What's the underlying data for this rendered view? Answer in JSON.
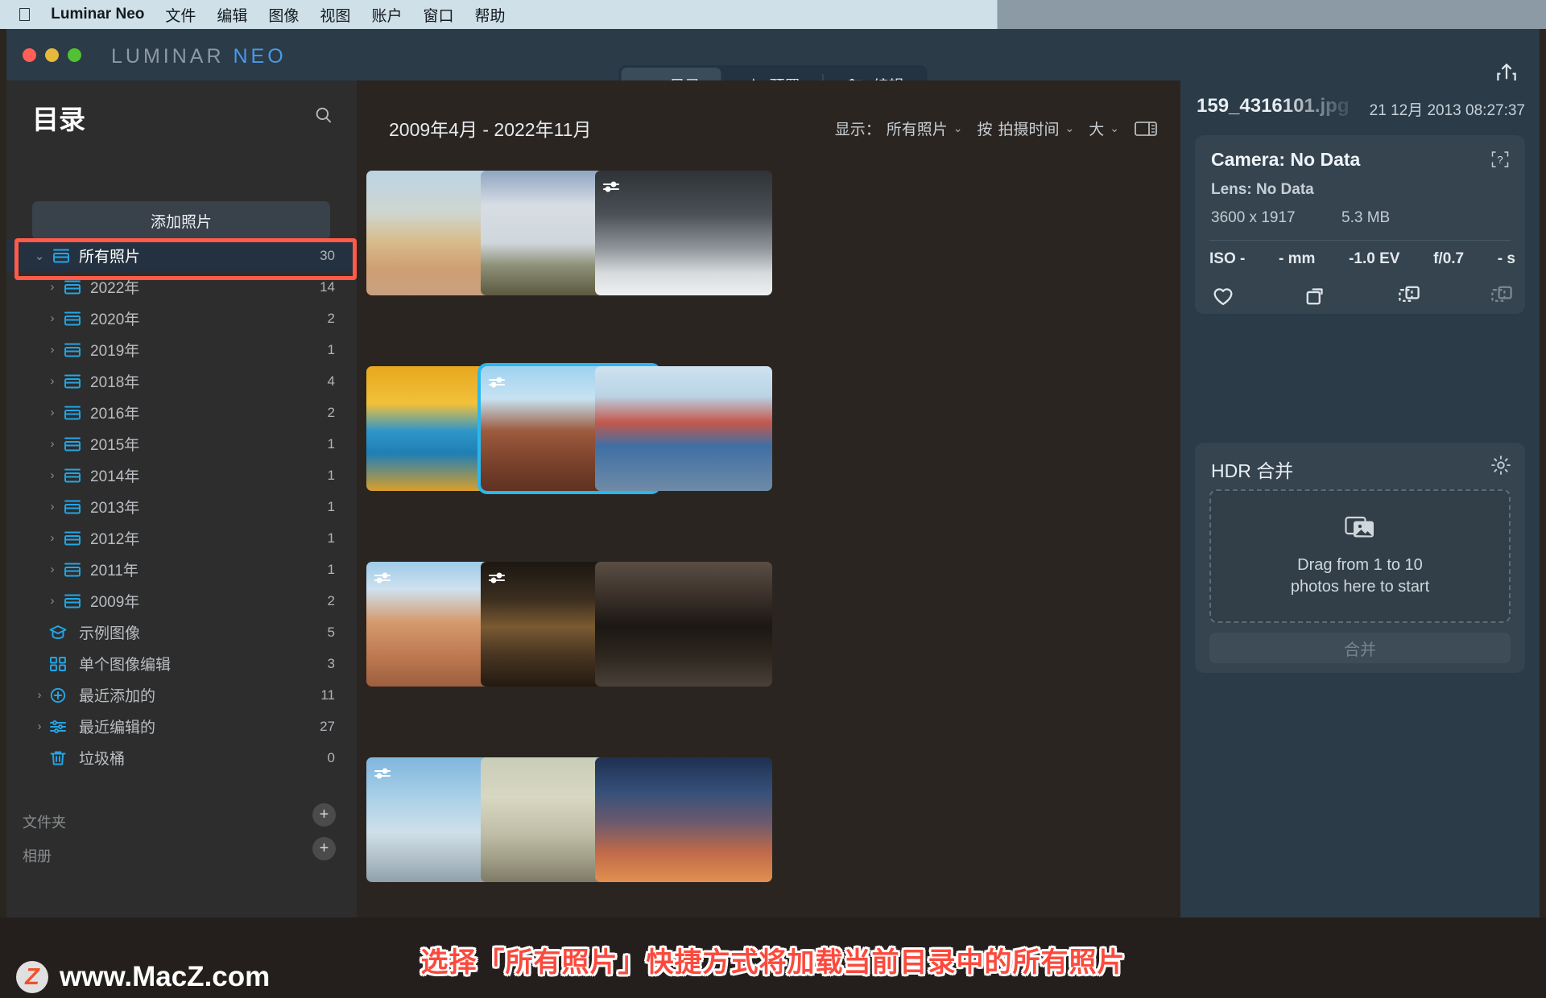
{
  "menubar": {
    "apple_icon": "apple-icon",
    "app_name": "Luminar Neo",
    "items": [
      "文件",
      "编辑",
      "图像",
      "视图",
      "账户",
      "窗口",
      "帮助"
    ]
  },
  "titlebar": {
    "brand_lum": "LUMINAR",
    "brand_neo": "NEO",
    "modes": [
      {
        "label": "目录",
        "icon": "folder-icon",
        "active": true
      },
      {
        "label": "预置",
        "icon": "sparkle-icon",
        "active": false
      },
      {
        "label": "编辑",
        "icon": "sliders-icon",
        "active": false
      }
    ],
    "share_icon": "share-icon"
  },
  "sidebar": {
    "title": "目录",
    "search_icon": "search-icon",
    "add_photos_label": "添加照片",
    "tree": [
      {
        "label": "所有照片",
        "count": "30",
        "level": 0,
        "chevron": "down",
        "icon": "catalog-icon",
        "selected": true
      },
      {
        "label": "2022年",
        "count": "14",
        "level": 1,
        "chevron": "right",
        "icon": "catalog-icon"
      },
      {
        "label": "2020年",
        "count": "2",
        "level": 1,
        "chevron": "right",
        "icon": "catalog-icon"
      },
      {
        "label": "2019年",
        "count": "1",
        "level": 1,
        "chevron": "right",
        "icon": "catalog-icon"
      },
      {
        "label": "2018年",
        "count": "4",
        "level": 1,
        "chevron": "right",
        "icon": "catalog-icon"
      },
      {
        "label": "2016年",
        "count": "2",
        "level": 1,
        "chevron": "right",
        "icon": "catalog-icon"
      },
      {
        "label": "2015年",
        "count": "1",
        "level": 1,
        "chevron": "right",
        "icon": "catalog-icon"
      },
      {
        "label": "2014年",
        "count": "1",
        "level": 1,
        "chevron": "right",
        "icon": "catalog-icon"
      },
      {
        "label": "2013年",
        "count": "1",
        "level": 1,
        "chevron": "right",
        "icon": "catalog-icon"
      },
      {
        "label": "2012年",
        "count": "1",
        "level": 1,
        "chevron": "right",
        "icon": "catalog-icon"
      },
      {
        "label": "2011年",
        "count": "1",
        "level": 1,
        "chevron": "right",
        "icon": "catalog-icon"
      },
      {
        "label": "2009年",
        "count": "2",
        "level": 1,
        "chevron": "right",
        "icon": "catalog-icon"
      },
      {
        "label": "示例图像",
        "count": "5",
        "level": 0,
        "chevron": "",
        "icon": "graduation-cap-icon"
      },
      {
        "label": "单个图像编辑",
        "count": "3",
        "level": 0,
        "chevron": "",
        "icon": "grid-squares-icon"
      },
      {
        "label": "最近添加的",
        "count": "11",
        "level": 0,
        "chevron": "right",
        "icon": "plus-circle-icon"
      },
      {
        "label": "最近编辑的",
        "count": "27",
        "level": 0,
        "chevron": "right",
        "icon": "sliders-icon"
      },
      {
        "label": "垃圾桶",
        "count": "0",
        "level": 0,
        "chevron": "",
        "icon": "trash-icon"
      }
    ],
    "sections": [
      {
        "label": "文件夹",
        "add_icon": "plus-icon"
      },
      {
        "label": "相册",
        "add_icon": "plus-icon"
      }
    ]
  },
  "content": {
    "date_range": "2009年4月 - 2022年11月",
    "filters": {
      "show_label": "显示：",
      "show_value": "所有照片",
      "sort_label": "按",
      "sort_value": "拍摄时间",
      "size_value": "大",
      "layout_icon": "split-view-icon"
    },
    "thumbnails": [
      {
        "name": "cattle-on-desert-road",
        "badge": ""
      },
      {
        "name": "cloudy-field-landscape",
        "badge": ""
      },
      {
        "name": "foggy-mountain-bw",
        "badge": "sliders-icon"
      },
      {
        "name": "golden-iceberg-sunset",
        "badge": ""
      },
      {
        "name": "brick-street-town",
        "badge": "sliders-icon",
        "selected": true
      },
      {
        "name": "colorful-canal-houses",
        "badge": ""
      },
      {
        "name": "bryce-canyon-hoodoos",
        "badge": "sliders-icon"
      },
      {
        "name": "night-cobblestone-alley",
        "badge": "sliders-icon"
      },
      {
        "name": "stone-archway-door",
        "badge": ""
      },
      {
        "name": "blue-sky-beach-row",
        "badge": "sliders-icon"
      },
      {
        "name": "pale-sunset-row",
        "badge": ""
      },
      {
        "name": "city-night-skyline-row",
        "badge": ""
      }
    ]
  },
  "rightpanel": {
    "file_name": "159_4316101.jpg",
    "file_date": "21 12月 2013 08:27:37",
    "camera": "Camera: No Data",
    "help_icon": "help-bracket-icon",
    "lens": "Lens: No Data",
    "dimensions": "3600 x 1917",
    "file_size": "5.3 MB",
    "exif": [
      "ISO -",
      "- mm",
      "-1.0 EV",
      "f/0.7",
      "- s"
    ],
    "actions": [
      {
        "icon": "heart-icon",
        "dim": false
      },
      {
        "icon": "rotate-icon",
        "dim": false
      },
      {
        "icon": "duplicate-icon",
        "dim": false
      },
      {
        "icon": "stack-icon",
        "dim": true
      }
    ],
    "hdr": {
      "title": "HDR 合并",
      "gear_icon": "gear-icon",
      "dropzone_icon": "photos-stack-icon",
      "dropzone_text": "Drag from 1 to 10\nphotos here to start",
      "merge_label": "合并"
    }
  },
  "annotation": {
    "caption": "选择「所有照片」快捷方式将加载当前目录中的所有照片",
    "watermark_logo": "Z",
    "watermark_text": "www.MacZ.com"
  },
  "colors": {
    "accent_cyan": "#28b8f0",
    "highlight_red": "#ff5b4a",
    "sidebar_bg": "#2d2d2d",
    "panel_bg": "#2b3b47"
  }
}
